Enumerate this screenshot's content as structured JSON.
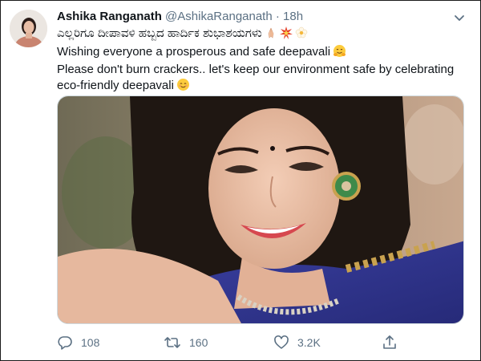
{
  "tweet": {
    "author_name": "Ashika Ranganath",
    "handle": "@AshikaRanganath",
    "separator": "·",
    "time": "18h",
    "text_lines": [
      "ಎಲ್ಲರಿಗೂ ದೀಪಾವಳಿ ಹಬ್ಬದ ಹಾರ್ದಿಕ ಶುಭಾಶಯಗಳು",
      "Wishing everyone a prosperous and safe deepavali",
      "Please don't burn crackers.. let's keep our environment safe by celebrating",
      "eco-friendly deepavali"
    ],
    "emojis": [
      "folded-hands",
      "collision",
      "blossom",
      "hugging-face",
      "smiling-face"
    ],
    "image_description": "portrait photo"
  },
  "actions": {
    "reply_count": "108",
    "retweet_count": "160",
    "like_count": "3.2K"
  },
  "colors": {
    "text": "#0f1419",
    "secondary": "#5b7083",
    "border": "#cfd9de"
  }
}
